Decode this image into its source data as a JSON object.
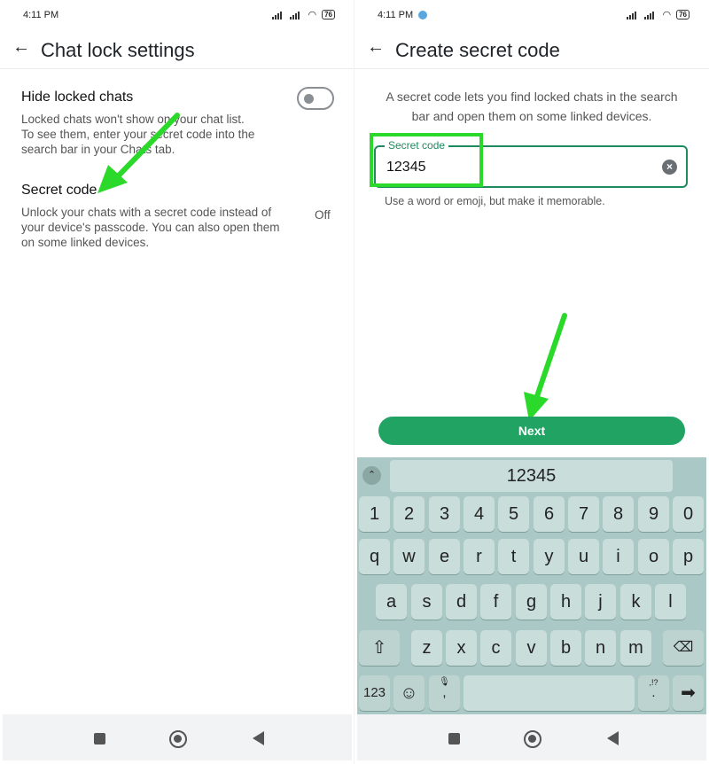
{
  "status": {
    "time_left": "4:11 PM",
    "time_right": "4:11 PM",
    "battery": "76"
  },
  "left": {
    "title": "Chat lock settings",
    "hide": {
      "label": "Hide locked chats",
      "desc_lines": [
        "Locked chats won't show on your chat list.",
        "To see them, enter your secret code into the",
        "search bar in your Chats tab."
      ],
      "toggle_on": false
    },
    "secret": {
      "label": "Secret code",
      "desc_lines": [
        "Unlock your chats with a secret code instead of",
        "your device's passcode. You can also open them",
        "on some linked devices."
      ],
      "value": "Off"
    }
  },
  "right": {
    "title": "Create secret code",
    "info_lines": [
      "A secret code lets you find locked chats in the search",
      "bar and open them on some linked devices."
    ],
    "field": {
      "label": "Secret code",
      "value": "12345"
    },
    "hint": "Use a word or emoji, but make it memorable.",
    "next_label": "Next"
  },
  "keyboard": {
    "suggestion": "12345",
    "rows": [
      [
        "1",
        "2",
        "3",
        "4",
        "5",
        "6",
        "7",
        "8",
        "9",
        "0"
      ],
      [
        "q",
        "w",
        "e",
        "r",
        "t",
        "y",
        "u",
        "i",
        "o",
        "p"
      ],
      [
        "a",
        "s",
        "d",
        "f",
        "g",
        "h",
        "j",
        "k",
        "l"
      ],
      [
        "z",
        "x",
        "c",
        "v",
        "b",
        "n",
        "m"
      ]
    ],
    "mode_key": "123",
    "comma_key": ",",
    "period_key": ".",
    "punct_hint": ",!?"
  },
  "colors": {
    "accent": "#21a463",
    "highlight": "#2bd92b",
    "keyboard_bg": "#aac8c5"
  },
  "icons": [
    "back-arrow-icon",
    "clear-icon",
    "shift-icon",
    "backspace-icon",
    "emoji-icon",
    "mic-icon",
    "enter-icon",
    "annotation-arrow-icon"
  ]
}
